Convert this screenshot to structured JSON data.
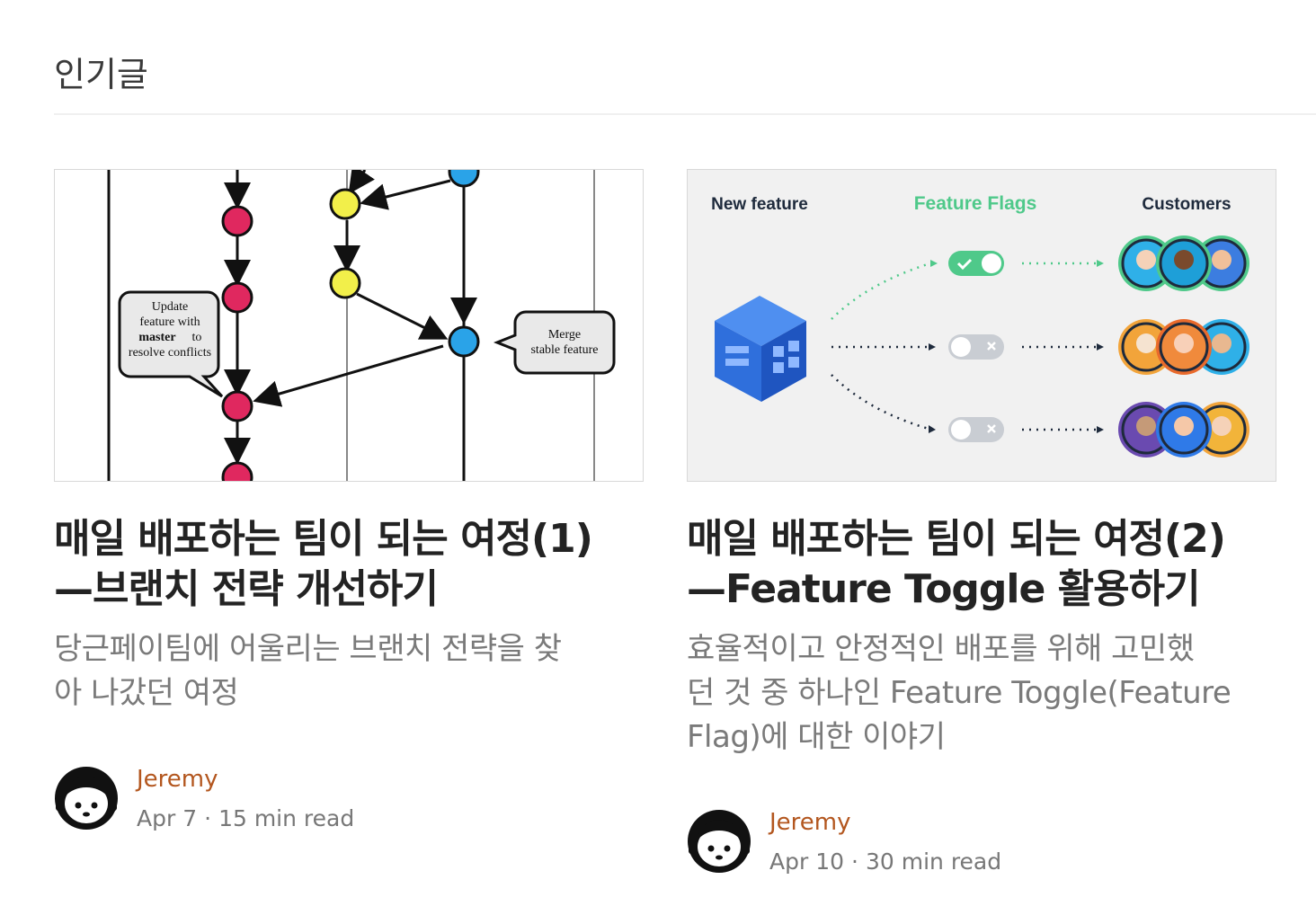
{
  "section": {
    "title": "인기글"
  },
  "posts": [
    {
      "image_labels": {
        "bubble_left": [
          "Update",
          "feature with",
          "master",
          "to",
          "resolve conflicts"
        ],
        "bubble_right": [
          "Merge",
          "stable feature"
        ]
      },
      "title_line1": "매일 배포하는 팀이 되는 여정(1)",
      "title_line2": "—브랜치 전략 개선하기",
      "subtitle_line1": "당근페이팀에 어울리는 브랜치 전략을 찾",
      "subtitle_line2": "아 나갔던 여정",
      "author": "Jeremy",
      "date": "Apr 7",
      "separator": "·",
      "read_time": "15 min read"
    },
    {
      "image_labels": {
        "col1": "New feature",
        "col2": "Feature Flags",
        "col3": "Customers"
      },
      "title_line1": "매일 배포하는 팀이 되는 여정(2)",
      "title_line2": "—Feature Toggle 활용하기",
      "subtitle_line1": "효율적이고 안정적인 배포를 위해 고민했",
      "subtitle_line2": "던 것 중 하나인 Feature Toggle(Feature",
      "subtitle_line3": "Flag)에 대한 이야기",
      "author": "Jeremy",
      "date": "Apr 10",
      "separator": "·",
      "read_time": "30 min read"
    }
  ],
  "colors": {
    "accent_author": "#b3561e",
    "flag_green": "#4fc98a",
    "node_red": "#e0285f",
    "node_yellow": "#f2ef4a",
    "node_blue": "#2aa3e8"
  }
}
